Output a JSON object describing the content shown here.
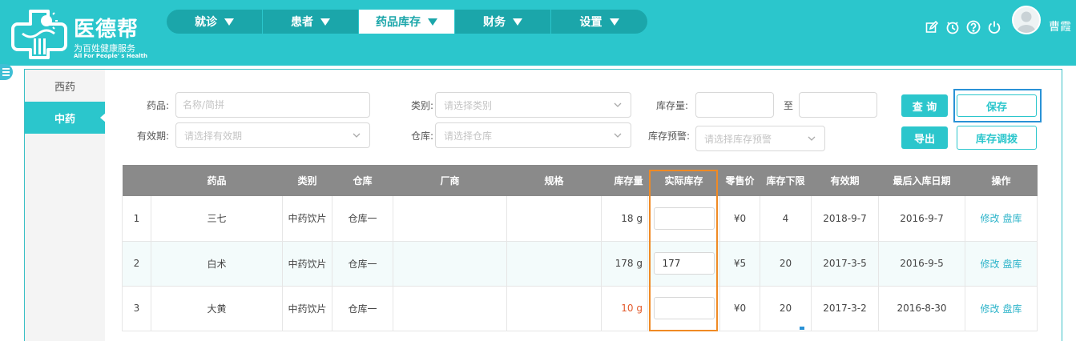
{
  "brand": {
    "name": "医德帮",
    "tagline": "为百姓健康服务",
    "tagline_en": "All For People' s Health"
  },
  "nav": [
    {
      "label": "就诊"
    },
    {
      "label": "患者"
    },
    {
      "label": "药品库存",
      "active": true
    },
    {
      "label": "财务"
    },
    {
      "label": "设置"
    }
  ],
  "header_icons": [
    "edit-icon",
    "timer-icon",
    "help-icon",
    "power-icon"
  ],
  "user": {
    "name": "曹霞"
  },
  "side": [
    {
      "label": "西药"
    },
    {
      "label": "中药",
      "active": true
    }
  ],
  "filters": {
    "drug_label": "药品:",
    "drug_placeholder": "名称/简拼",
    "category_label": "类别:",
    "category_placeholder": "请选择类别",
    "stock_label": "库存量:",
    "stock_to": "至",
    "expiry_label": "有效期:",
    "expiry_placeholder": "请选择有效期",
    "warehouse_label": "仓库:",
    "warehouse_placeholder": "请选择仓库",
    "alert_label": "库存预警:",
    "alert_placeholder": "请选择库存预警"
  },
  "buttons": {
    "query": "查 询",
    "save": "保存",
    "export": "导出",
    "adjust": "库存调拨"
  },
  "table": {
    "headers": [
      "",
      "药品",
      "类别",
      "仓库",
      "厂商",
      "规格",
      "库存量",
      "实际库存",
      "零售价",
      "库存下限",
      "有效期",
      "最后入库日期",
      "操作"
    ],
    "rows": [
      {
        "no": "1",
        "drug": "三七",
        "category": "中药饮片",
        "warehouse": "仓库一",
        "maker": "",
        "spec": "",
        "stock": "18 g",
        "actual": "",
        "price": "¥0",
        "min": "4",
        "expiry": "2018-9-7",
        "last_in": "2016-9-7",
        "low": false
      },
      {
        "no": "2",
        "drug": "白术",
        "category": "中药饮片",
        "warehouse": "仓库一",
        "maker": "",
        "spec": "",
        "stock": "178 g",
        "actual": "177",
        "price": "¥5",
        "min": "20",
        "expiry": "2017-3-5",
        "last_in": "2016-9-5",
        "low": false
      },
      {
        "no": "3",
        "drug": "大黄",
        "category": "中药饮片",
        "warehouse": "仓库一",
        "maker": "",
        "spec": "",
        "stock": "10 g",
        "actual": "",
        "price": "¥0",
        "min": "20",
        "expiry": "2017-3-2",
        "last_in": "2016-8-30",
        "low": true
      }
    ],
    "ops": {
      "edit": "修改",
      "check": "盘库"
    }
  },
  "colors": {
    "primary": "#2bc6cc",
    "nav_bg": "#1ba6aa",
    "low_stock": "#e35a2c",
    "highlight": "#f08a24",
    "focus": "#2a92d6"
  }
}
